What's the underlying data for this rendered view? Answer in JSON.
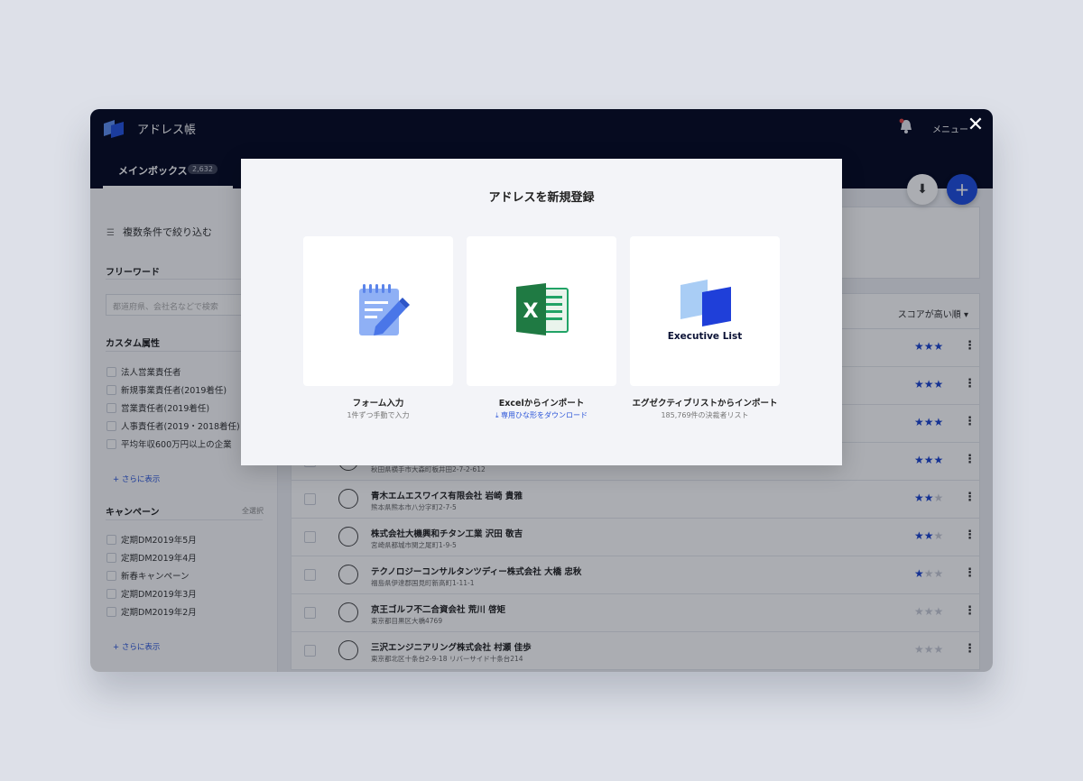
{
  "header": {
    "app_title": "アドレス帳",
    "menu_label": "メニュー"
  },
  "tabs": [
    {
      "label": "メインボックス",
      "count": "2,632"
    }
  ],
  "sidebar": {
    "filter_label": "複数条件で絞り込む",
    "freeword": {
      "heading": "フリーワード",
      "placeholder": "都道府県、会社名などで検索"
    },
    "custom_attr": {
      "heading": "カスタム属性",
      "items": [
        "法人営業責任者",
        "新規事業責任者(2019着任)",
        "営業責任者(2019着任)",
        "人事責任者(2019・2018着任)",
        "平均年収600万円以上の企業"
      ],
      "more": "+ さらに表示"
    },
    "campaign": {
      "heading": "キャンペーン",
      "select_all": "全選択",
      "items": [
        "定期DM2019年5月",
        "定期DM2019年4月",
        "新春キャンペーン",
        "定期DM2019年3月",
        "定期DM2019年2月"
      ],
      "more": "+ さらに表示"
    }
  },
  "list": {
    "sort_label": "スコアが高い順 ▾",
    "rows": [
      {
        "name": "",
        "address": "",
        "score": 3
      },
      {
        "name": "",
        "address": "",
        "score": 3
      },
      {
        "name": "",
        "address": "",
        "score": 3
      },
      {
        "name": "",
        "address": "秋田県横手市大森町板井田2-7-2-612",
        "score": 3
      },
      {
        "name": "青木エムエスワイス有限会社 岩崎 貴雅",
        "address": "熊本県熊本市八分字町2-7-5",
        "score": 2
      },
      {
        "name": "株式会社大機興和チタン工業 沢田 敬吉",
        "address": "宮崎県都城市関之尾町1-9-5",
        "score": 2
      },
      {
        "name": "テクノロジーコンサルタンツディー株式会社 大橋 忠秋",
        "address": "福島県伊達郡国見町新高町1-11-1",
        "score": 1.5
      },
      {
        "name": "京王ゴルフ不二合資会社 荒川 啓矩",
        "address": "東京都目黒区大橋4769",
        "score": 0
      },
      {
        "name": "三沢エンジニアリング株式会社 村瀬 佳歩",
        "address": "東京都北区十条台2-9-18 リバーサイド十条台214",
        "score": 0
      }
    ]
  },
  "modal": {
    "title": "アドレスを新規登録",
    "options": [
      {
        "label": "フォーム入力",
        "sub": "1件ずつ手動で入力"
      },
      {
        "label": "Excelからインポート",
        "sub": "専用ひな形をダウンロード"
      },
      {
        "label": "エグゼクティブリストからインポート",
        "sub": "185,769件の決裁者リスト",
        "logo_text": "Executive List"
      }
    ]
  },
  "icons": {
    "close": "close-icon",
    "bell": "bell-icon",
    "cloud": "cloud-download-icon",
    "plus": "plus-icon",
    "form": "notepad-pencil-icon",
    "excel": "excel-icon",
    "exec": "executive-list-logo",
    "download": "download-icon"
  },
  "colors": {
    "topbar": "#050a22",
    "accent": "#1f4ee0",
    "star": "#1c45d1",
    "excel_green": "#1f7a43"
  }
}
